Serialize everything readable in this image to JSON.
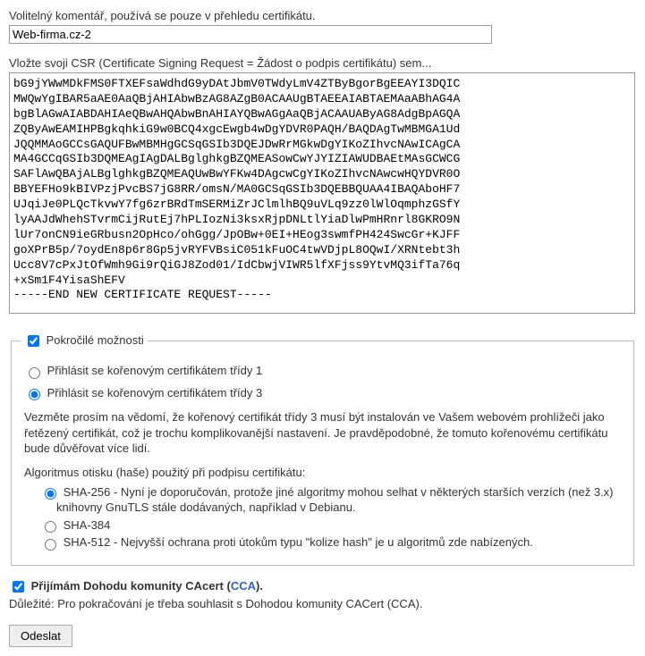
{
  "comment": {
    "label": "Volitelný komentář, používá se pouze v přehledu certifikátu.",
    "value": "Web-firma.cz-2"
  },
  "csr": {
    "label": "Vložte svoji CSR (Certificate Signing Request = Žádost o podpis certifikátu) sem...",
    "value": "bG9jYWwMDkFMS0FTXEFsaWdhdG9yDAtJbmV0TWdyLmV4ZTByBgorBgEEAYI3DQIC\nMWQwYgIBAR5aAE0AaQBjAHIAbwBzAG8AZgB0ACAAUgBTAEEAIABTAEMAaABhAG4A\nbgBlAGwAIABDAHIAeQBwAHQAbwBnAHIAYQBwAGgAaQBjACAAUAByAG8AdgBpAGQA\nZQByAwEAMIHPBgkqhkiG9w0BCQ4xgcEwgb4wDgYDVR0PAQH/BAQDAgTwMBMGA1Ud\nJQQMMAoGCCsGAQUFBwMBMHgGCSqGSIb3DQEJDwRrMGkwDgYIKoZIhvcNAwICAgCA\nMA4GCCqGSIb3DQMEAgIAgDALBglghkgBZQMEASowCwYJYIZIAWUDBAEtMAsGCWCG\nSAFlAwQBAjALBglghkgBZQMEAQUwBwYFKw4DAgcwCgYIKoZIhvcNAwcwHQYDVR0O\nBBYEFHo9kBIVPzjPvcBS7jG8RR/omsN/MA0GCSqGSIb3DQEBBQUAA4IBAQAboHF7\nUJqiJe0PLQcTkvwY7fg6zrBRdTmSERMiZrJClmlhBQ9uVLq9zz0lWlOqmphzGSfY\nlyAAJdWhehSTvrmCijRutEj7hPLIozNi3ksxRjpDNLtlYiaDlwPmHRnrl8GKRO9N\nlUr7onCN9ieGRbusn2OpHco/ohGgg/JpOBw+0EI+HEog3swmfPH424SwcGr+KJFF\ngoXPrB5p/7oydEn8p6r8Gp5jvRYFVBsiC051kFuOC4twVDjpL8OQwI/XRNtebt3h\nUcc8V7cPxJtOfWmh9Gi9rQiGJ8Zod01/IdCbwjVIWR5lfXFjss9YtvMQ3ifTa76q\n+xSm1F4YisaShEFV\n-----END NEW CERTIFICATE REQUEST-----"
  },
  "advanced": {
    "legend": "Pokročilé možnosti",
    "root1": "Přihlásit se kořenovým certifikátem třídy 1",
    "root3": "Přihlásit se kořenovým certifikátem třídy 3",
    "note": "Vezměte prosím na vědomí, že kořenový certifikát třídy 3 musí být instalován ve Vašem webovém prohlížeči jako řetězený certifikát, což je trochu komplikovanější nastavení. Je pravděpodobné, že tomuto kořenovému certifikátu bude důvěřovat více lidí.",
    "algoLabel": "Algoritmus otisku (haše) použitý při podpisu certifikátu:",
    "sha256": "SHA-256 - Nyní je doporučován, protože jiné algoritmy mohou selhat v některých starších verzích (než 3.x) knihovny GnuTLS stále dodávaných, například v Debianu.",
    "sha384": "SHA-384",
    "sha512": "SHA-512 - Nejvyšší ochrana proti útokům typu \"kolize hash\" je u algoritmů zde nabízených."
  },
  "cca": {
    "textBefore": "Přijímám Dohodu komunity CAcert (",
    "link": "CCA",
    "textAfter": ").",
    "important": "Důležité: Pro pokračování je třeba souhlasit s Dohodou komunity CACert (CCA)."
  },
  "submit": "Odeslat"
}
